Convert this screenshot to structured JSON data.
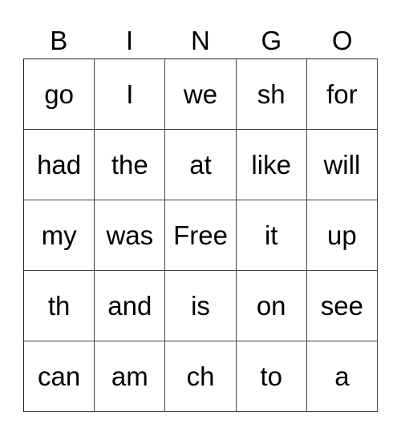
{
  "card": {
    "header": [
      "B",
      "I",
      "N",
      "G",
      "O"
    ],
    "rows": [
      [
        "go",
        "I",
        "we",
        "sh",
        "for"
      ],
      [
        "had",
        "the",
        "at",
        "like",
        "will"
      ],
      [
        "my",
        "was",
        "Free",
        "it",
        "up"
      ],
      [
        "th",
        "and",
        "is",
        "on",
        "see"
      ],
      [
        "can",
        "am",
        "ch",
        "to",
        "a"
      ]
    ]
  }
}
